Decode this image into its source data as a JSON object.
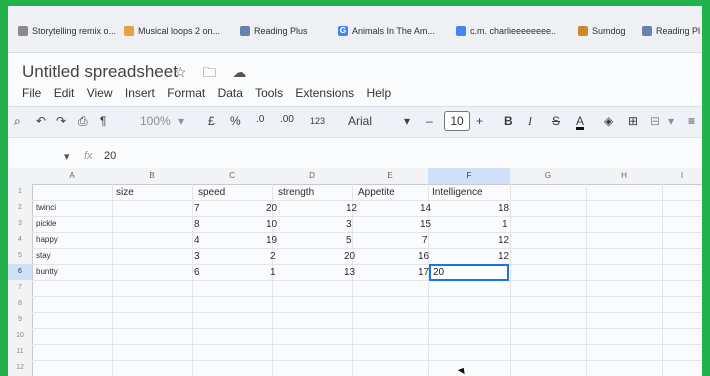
{
  "bookmarks": [
    {
      "label": "Storytelling remix o...",
      "icon": "document-icon",
      "color": "#8a8a8a"
    },
    {
      "label": "Musical loops 2 on...",
      "icon": "bookmark-icon",
      "color": "#e8a040"
    },
    {
      "label": "Reading Plus",
      "icon": "reading-plus-icon",
      "color": "#6b7fb0"
    },
    {
      "label": "Animals In The Am...",
      "icon": "google-icon",
      "color": "#4285f4"
    },
    {
      "label": "c.m. charlieeeeeeee..",
      "icon": "docs-icon",
      "color": "#4285f4"
    },
    {
      "label": "Sumdog",
      "icon": "sumdog-icon",
      "color": "#c98a2b"
    },
    {
      "label": "Reading Pl",
      "icon": "reading-plus-icon",
      "color": "#6b7fb0"
    }
  ],
  "doc": {
    "title": "Untitled spreadsheet",
    "star": "☆",
    "folder": "🗀",
    "cloud": "☁"
  },
  "menu": [
    "File",
    "Edit",
    "View",
    "Insert",
    "Format",
    "Data",
    "Tools",
    "Extensions",
    "Help"
  ],
  "toolbar": {
    "search": "⌕",
    "undo": "↶",
    "redo": "↷",
    "print": "⎙",
    "paint": "¶",
    "zoom": "100%",
    "zoom_caret": "▾",
    "currency": "£",
    "percent": "%",
    "dec_less": ".0",
    "dec_more": ".00",
    "format_num": "123",
    "font": "Arial",
    "font_caret": "▾",
    "minus": "–",
    "font_size": "10",
    "plus": "+",
    "bold": "B",
    "italic": "I",
    "strike": "S",
    "text_color": "A",
    "fill": "◈",
    "borders": "⊞",
    "merge": "⊟",
    "merge_caret": "▾",
    "align": "≡"
  },
  "formula": {
    "name_caret": "▾",
    "fx": "fx",
    "value": "20"
  },
  "columns": [
    "A",
    "B",
    "C",
    "D",
    "E",
    "F",
    "G",
    "H",
    "I"
  ],
  "selected_column": "F",
  "rows": [
    "1",
    "2",
    "3",
    "4",
    "5",
    "6",
    "7",
    "8",
    "9",
    "10",
    "11",
    "12"
  ],
  "selected_row": "6",
  "headers_row": [
    "size",
    "speed",
    "strength",
    "Appetite",
    "Intelligence"
  ],
  "data_rows": [
    {
      "name": "twinci",
      "speed": "7",
      "strength": "20",
      "appetite": "12",
      "e": "14",
      "f": "18"
    },
    {
      "name": "pickle",
      "speed": "8",
      "strength": "10",
      "appetite": "3",
      "e": "15",
      "f": "1"
    },
    {
      "name": "happy",
      "speed": "4",
      "strength": "19",
      "appetite": "5",
      "e": "7",
      "f": "12"
    },
    {
      "name": "stay",
      "speed": "3",
      "strength": "2",
      "appetite": "20",
      "e": "16",
      "f": "12"
    },
    {
      "name": "buntty",
      "speed": "6",
      "strength": "1",
      "appetite": "13",
      "e": "17",
      "f": "20"
    }
  ],
  "accent": "#1a73e8",
  "frame_color": "#22b14c"
}
